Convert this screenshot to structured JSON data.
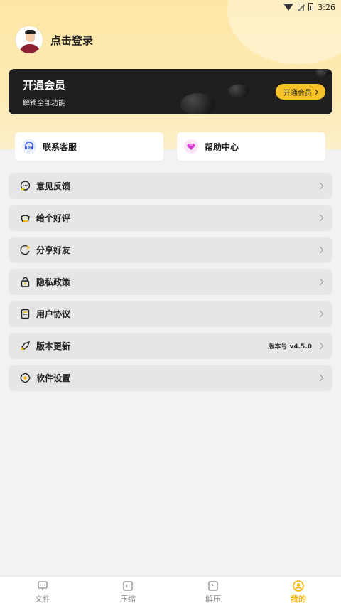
{
  "status_bar": {
    "time": "3:26"
  },
  "profile": {
    "login_text": "点击登录"
  },
  "vip": {
    "title": "开通会员",
    "subtitle": "解锁全部功能",
    "button_label": "开通会员"
  },
  "quick_actions": [
    {
      "label": "联系客服",
      "icon": "headset-icon"
    },
    {
      "label": "帮助中心",
      "icon": "diamond-icon"
    }
  ],
  "menu": [
    {
      "label": "意见反馈",
      "icon": "feedback-icon",
      "extra": ""
    },
    {
      "label": "给个好评",
      "icon": "thumbs-up-icon",
      "extra": ""
    },
    {
      "label": "分享好友",
      "icon": "share-icon",
      "extra": ""
    },
    {
      "label": "隐私政策",
      "icon": "lock-icon",
      "extra": ""
    },
    {
      "label": "用户协议",
      "icon": "document-icon",
      "extra": ""
    },
    {
      "label": "版本更新",
      "icon": "rocket-icon",
      "extra": "版本号 v4.5.0"
    },
    {
      "label": "软件设置",
      "icon": "gear-icon",
      "extra": ""
    }
  ],
  "tabs": [
    {
      "label": "文件",
      "icon": "file-icon",
      "active": false
    },
    {
      "label": "压缩",
      "icon": "compress-icon",
      "active": false
    },
    {
      "label": "解压",
      "icon": "extract-icon",
      "active": false
    },
    {
      "label": "我的",
      "icon": "profile-icon",
      "active": true
    }
  ],
  "colors": {
    "accent": "#f2b705",
    "vip_button": "#f7c227",
    "vip_card": "#1f1f1f",
    "hero_bg": "#fde7a6"
  }
}
